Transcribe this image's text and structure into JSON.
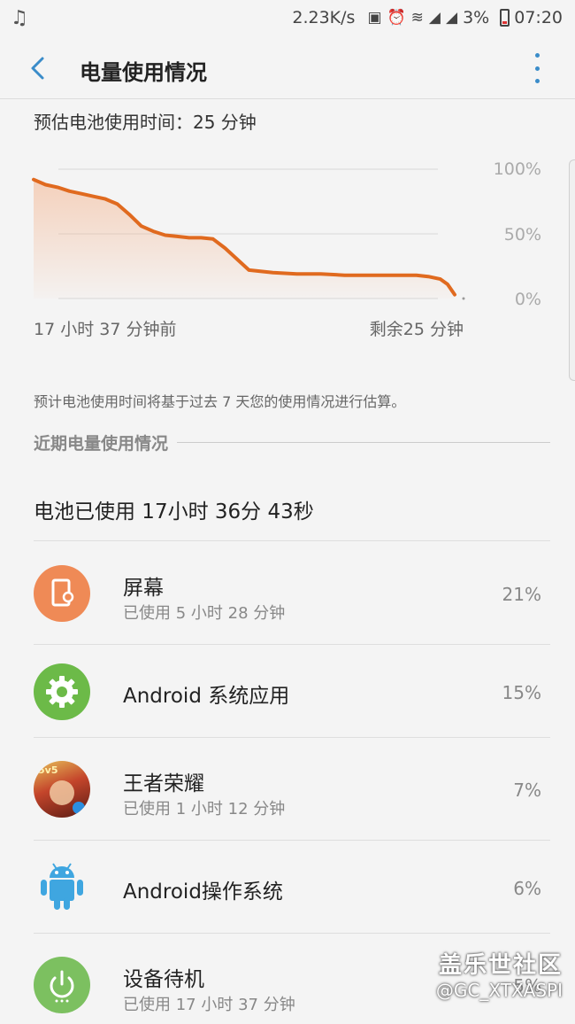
{
  "status_bar": {
    "speed": "2.23K/s",
    "battery_percent": "3%",
    "time": "07:20",
    "icons": [
      "music-note-icon",
      "battery-saver-icon",
      "alarm-icon",
      "wifi-icon",
      "4g-signal-icon",
      "cell-signal-icon",
      "battery-low-icon"
    ]
  },
  "header": {
    "title": "电量使用情况"
  },
  "estimate": {
    "text": "预估电池使用时间：25 分钟"
  },
  "chart_data": {
    "type": "area",
    "x_start_label": "17 小时 37 分钟前",
    "x_end_label": "剩余25 分钟",
    "y_ticks": [
      "100%",
      "50%",
      "0%"
    ],
    "ylim": [
      0,
      100
    ],
    "grid": true,
    "x_hours": [
      0,
      0.5,
      1,
      1.5,
      2,
      2.5,
      3,
      3.5,
      4,
      4.5,
      5,
      5.5,
      6,
      6.5,
      7,
      7.5,
      8,
      9,
      10,
      11,
      12,
      13,
      14,
      15,
      16,
      16.5,
      17,
      17.3,
      17.6
    ],
    "values": [
      92,
      88,
      86,
      83,
      81,
      79,
      77,
      73,
      65,
      56,
      52,
      49,
      48,
      47,
      47,
      46,
      39,
      22,
      20,
      19,
      19,
      18,
      18,
      18,
      18,
      17,
      15,
      11,
      3
    ],
    "color": "#e06a1f"
  },
  "note": "预计电池使用时间将基于过去 7 天您的使用情况进行估算。",
  "section_title": "近期电量使用情况",
  "total_used": "电池已使用 17小时 36分 43秒",
  "apps": [
    {
      "name": "屏幕",
      "sub": "已使用 5 小时 28 分钟",
      "pct": "21%",
      "icon": "screen-icon"
    },
    {
      "name": "Android 系统应用",
      "sub": "",
      "pct": "15%",
      "icon": "gear-icon"
    },
    {
      "name": "王者荣耀",
      "sub": "已使用 1 小时 12 分钟",
      "pct": "7%",
      "icon": "game-icon"
    },
    {
      "name": "Android操作系统",
      "sub": "",
      "pct": "6%",
      "icon": "android-icon"
    },
    {
      "name": "设备待机",
      "sub": "已使用 17 小时 37 分钟",
      "pct": "5%",
      "icon": "power-icon"
    }
  ],
  "watermark": {
    "line1": "盖乐世社区",
    "line2": "@GC_XTXASPI"
  }
}
